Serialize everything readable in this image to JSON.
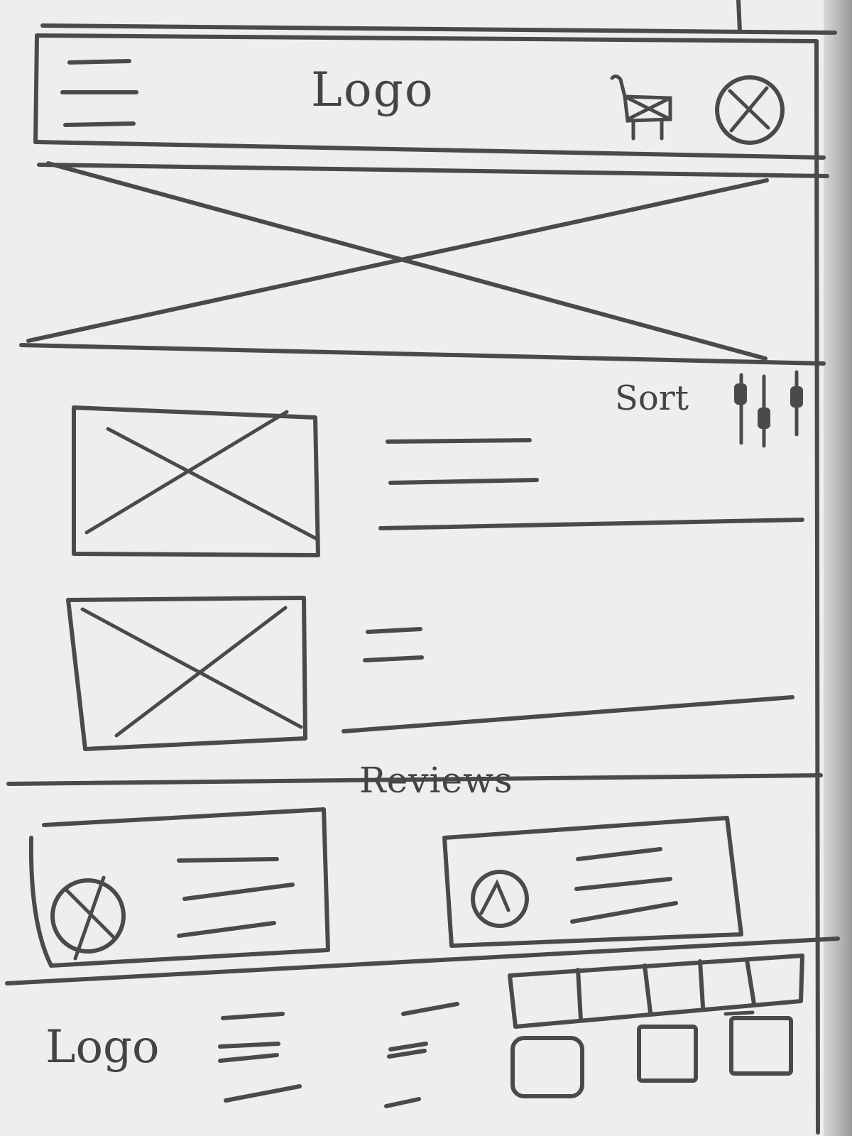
{
  "header": {
    "logo_text": "Logo",
    "menu_icon": "hamburger-menu-icon",
    "cart_icon": "shopping-cart-icon",
    "account_icon": "account-placeholder-icon"
  },
  "hero": {
    "image_icon": "image-placeholder-icon"
  },
  "listing": {
    "sort_label": "Sort",
    "filter_icon": "sliders-filter-icon",
    "products": [
      {
        "image_icon": "image-placeholder-icon"
      },
      {
        "image_icon": "image-placeholder-icon"
      }
    ]
  },
  "reviews": {
    "title": "Reviews",
    "cards": [
      {
        "avatar_icon": "avatar-placeholder-icon"
      },
      {
        "avatar_icon": "avatar-placeholder-icon"
      }
    ]
  },
  "footer": {
    "logo_text": "Logo",
    "social_icons": [
      "social-icon",
      "social-icon",
      "social-icon",
      "social-icon",
      "social-icon",
      "social-icon",
      "social-icon",
      "social-icon"
    ]
  },
  "colors": {
    "paper": "#eeeeee",
    "pencil": "#4a4a4a",
    "background": "#2a2a2a"
  }
}
